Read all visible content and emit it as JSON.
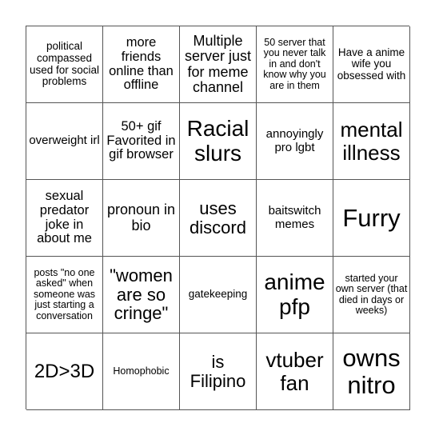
{
  "board": {
    "rows": [
      [
        "political compassed used for social problems",
        "more friends online than offline",
        "Multiple server just for meme channel",
        "50 server that you never talk in and don't know why you are in them",
        "Have a anime wife you obsessed with"
      ],
      [
        "overweight irl",
        "50+ gif Favorited in gif browser",
        "Racial slurs",
        "annoyingly pro lgbt",
        "mental illness"
      ],
      [
        "sexual predator joke in about me",
        "pronoun in bio",
        "uses discord",
        "baitswitch memes",
        "Furry"
      ],
      [
        "posts \"no one asked\" when someone was just starting a conversation",
        "\"women are so cringe\"",
        "gatekeeping",
        "anime pfp",
        "started your own server (that died in days or weeks)"
      ],
      [
        "2D>3D",
        "Homophobic",
        "is Filipino",
        "vtuber fan",
        "owns nitro"
      ]
    ]
  }
}
